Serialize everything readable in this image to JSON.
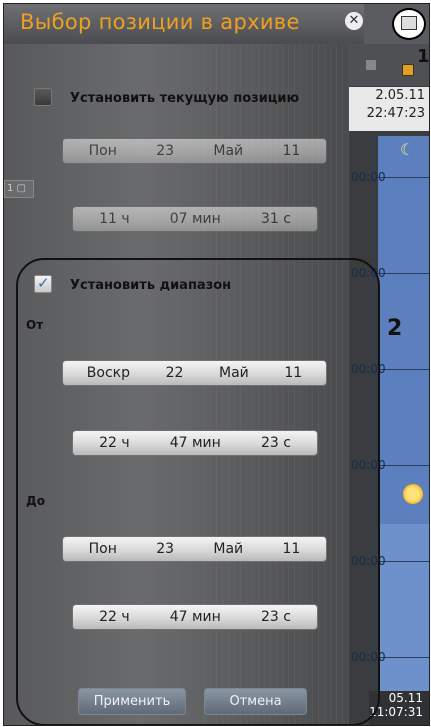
{
  "window": {
    "title": "Выбор позиции в архиве",
    "callout_1": "1",
    "callout_2": "2"
  },
  "current_position": {
    "checkbox_label": "Установить текущую позицию",
    "checked": false,
    "date": {
      "weekday": "Пон",
      "day": "23",
      "month": "Май",
      "year": "11"
    },
    "time": {
      "hours": "11 ч",
      "minutes": "07 мин",
      "seconds": "31 с"
    }
  },
  "range": {
    "checkbox_label": "Установить диапазон",
    "checked": true,
    "from_label": "От",
    "from_date": {
      "weekday": "Воскр",
      "day": "22",
      "month": "Май",
      "year": "11"
    },
    "from_time": {
      "hours": "22 ч",
      "minutes": "47 мин",
      "seconds": "23 с"
    },
    "to_label": "До",
    "to_date": {
      "weekday": "Пон",
      "day": "23",
      "month": "Май",
      "year": "11"
    },
    "to_time": {
      "hours": "22 ч",
      "minutes": "47 мин",
      "seconds": "23 с"
    }
  },
  "buttons": {
    "apply": "Применить",
    "cancel": "Отмена"
  },
  "timeline": {
    "top_date_line1": "2.05.11",
    "top_date_line2": "22:47:23",
    "marks": [
      "00:00",
      "00:00",
      "00:00",
      "00:00",
      "00:00",
      "00:00"
    ],
    "bottom_date_line1": "05.11",
    "bottom_date_line2": "11:07:31"
  },
  "colors": {
    "title": "#f0a020",
    "timeline_blue": "#5c7fbd"
  }
}
